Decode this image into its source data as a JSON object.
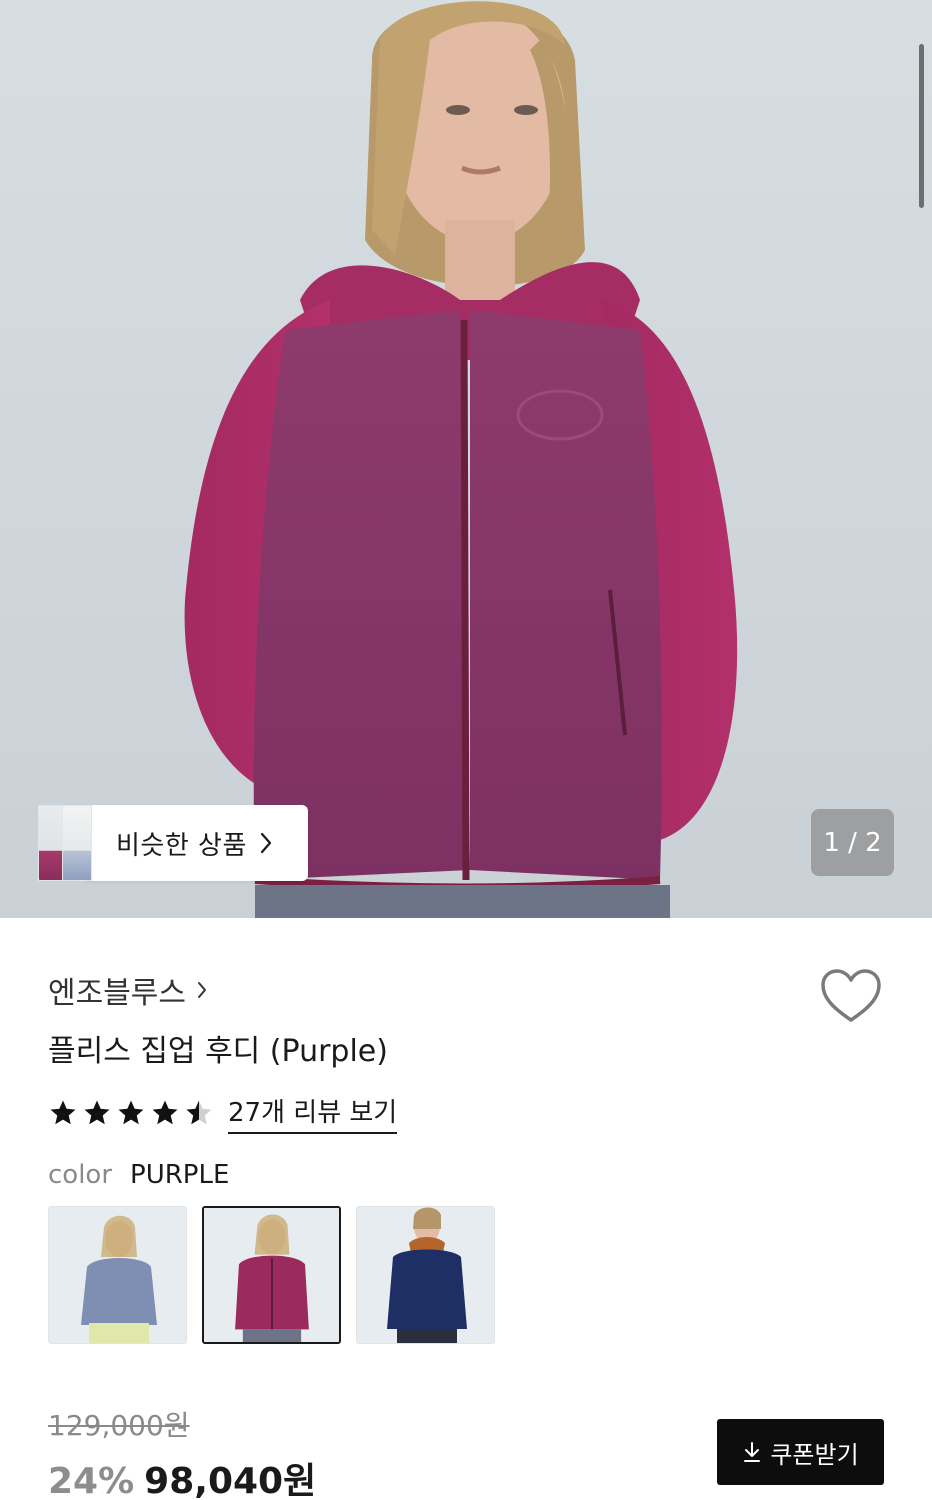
{
  "gallery": {
    "similar_label": "비슷한 상품",
    "counter": "1 / 2"
  },
  "product": {
    "brand": "엔조블루스",
    "title": "플리스 집업 후디 (Purple)",
    "rating": 4.5,
    "review_link": "27개 리뷰 보기",
    "color_key": "color",
    "color_value": "PURPLE",
    "color_options": [
      {
        "name": "blue",
        "swatch": "#7f8fb3"
      },
      {
        "name": "purple",
        "swatch": "#9b2a5d",
        "selected": true
      },
      {
        "name": "navy",
        "swatch": "#1e2f66"
      }
    ],
    "original_price": "129,000원",
    "discount": "24%",
    "sale_price": "98,040원",
    "coupon_label": "쿠폰받기"
  },
  "icons": {
    "chevron": "chevron-right-icon",
    "heart": "heart-outline-icon",
    "star": "star-icon",
    "download": "download-icon"
  }
}
